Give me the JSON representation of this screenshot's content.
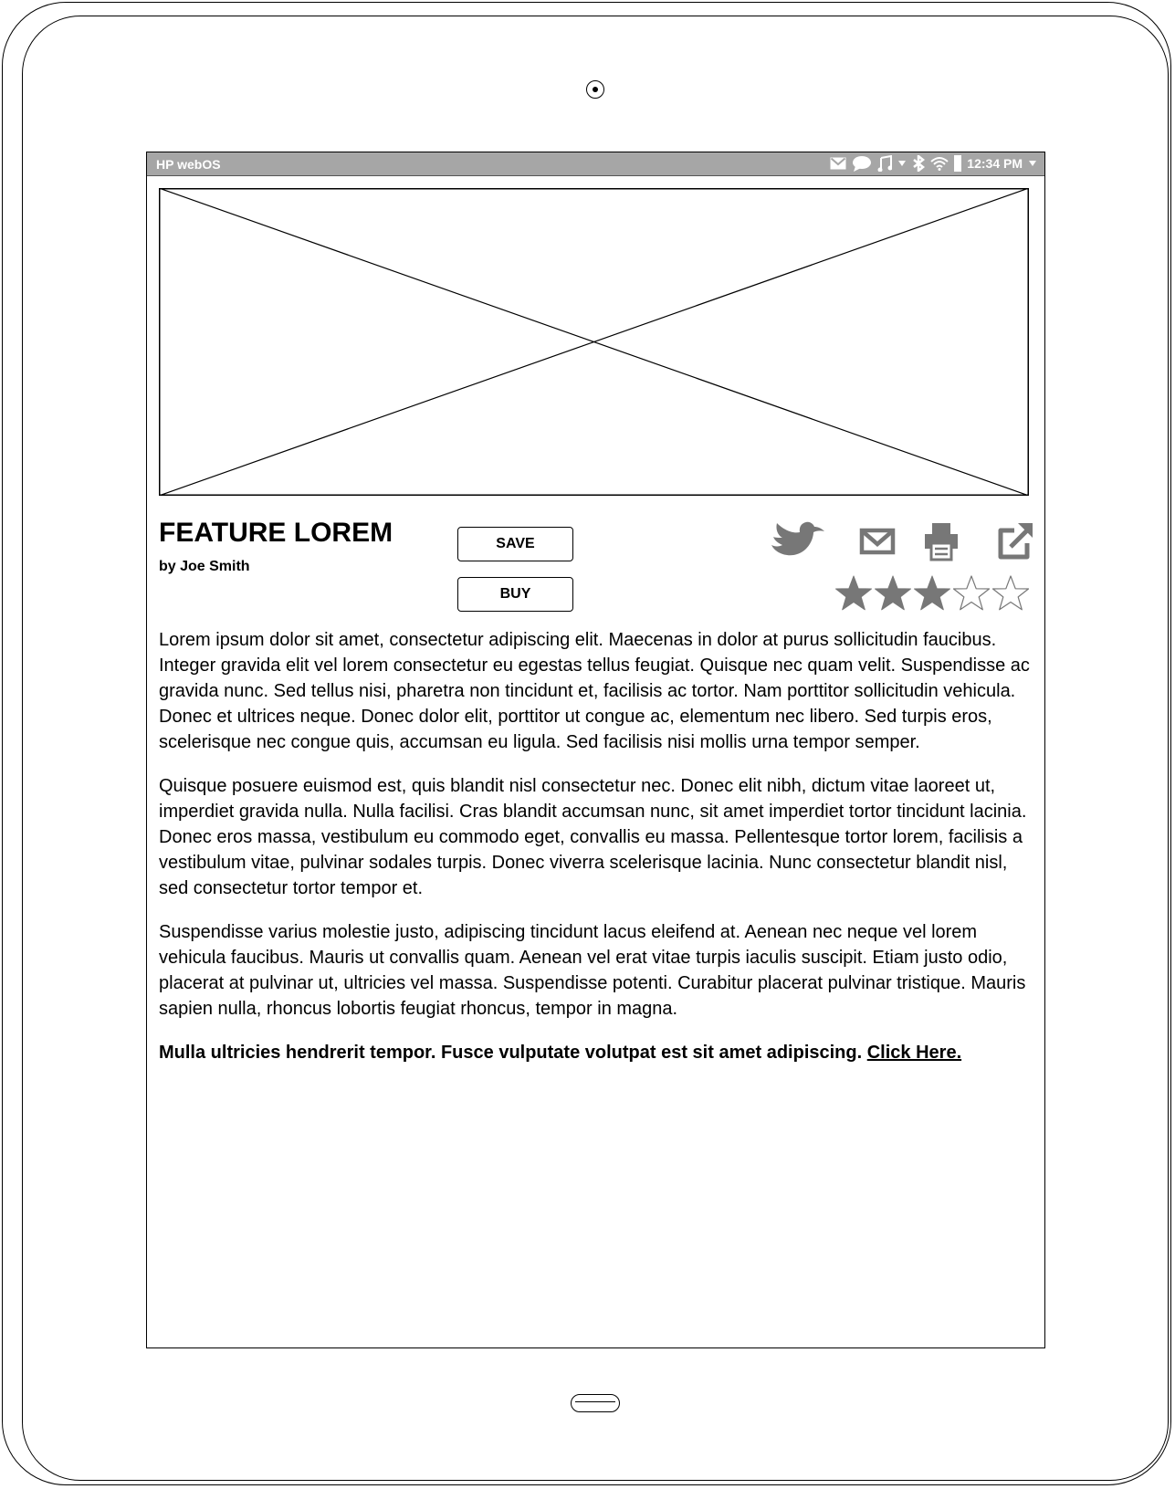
{
  "status_bar": {
    "os_name": "HP webOS",
    "time": "12:34 PM",
    "icons": [
      "mail-icon",
      "chat-icon",
      "music-icon",
      "dropdown-arrow-icon",
      "bluetooth-icon",
      "wifi-icon",
      "battery-icon",
      "dropdown-arrow-icon"
    ]
  },
  "article": {
    "title": "FEATURE LOREM",
    "byline": "by Joe Smith",
    "paragraphs": [
      "Lorem ipsum dolor sit amet, consectetur adipiscing elit. Maecenas in dolor at purus sollicitudin faucibus. Integer gravida elit vel lorem consectetur eu egestas tellus feugiat. Quisque nec quam velit. Suspendisse ac gravida nunc. Sed tellus nisi, pharetra non tincidunt et, facilisis ac tortor. Nam porttitor sollicitudin vehicula. Donec et ultrices neque. Donec dolor elit, porttitor ut congue ac, elementum nec libero. Sed turpis eros, scelerisque nec congue quis, accumsan eu ligula. Sed facilisis nisi mollis urna tempor semper.",
      "Quisque posuere euismod est, quis blandit nisl consectetur nec. Donec elit nibh, dictum vitae laoreet ut, imperdiet gravida nulla. Nulla facilisi. Cras blandit accumsan nunc, sit amet imperdiet tortor tincidunt lacinia. Donec eros massa, vestibulum eu commodo eget, convallis eu massa. Pellentesque tortor lorem, facilisis a vestibulum vitae, pulvinar sodales turpis. Donec viverra scelerisque lacinia. Nunc consectetur blandit nisl, sed consectetur tortor tempor et.",
      "Suspendisse varius molestie justo, adipiscing tincidunt lacus eleifend at. Aenean nec neque vel lorem vehicula faucibus. Mauris ut convallis quam. Aenean vel erat vitae turpis iaculis suscipit. Etiam justo odio, placerat at pulvinar ut, ultricies vel massa. Suspendisse potenti. Curabitur placerat pulvinar tristique. Mauris sapien nulla, rhoncus lobortis feugiat rhoncus, tempor in magna."
    ],
    "callout": "Mulla ultricies hendrerit tempor. Fusce vulputate volutpat est sit amet adipiscing.",
    "link_text": "Click Here."
  },
  "actions": {
    "save_label": "SAVE",
    "buy_label": "BUY"
  },
  "share_icons": [
    "twitter-icon",
    "email-icon",
    "print-icon",
    "external-link-icon"
  ],
  "rating": {
    "value": 3,
    "max": 5
  },
  "colors": {
    "status_bar": "#a6a6a6",
    "icon_gray": "#777777",
    "outline": "#000000"
  }
}
